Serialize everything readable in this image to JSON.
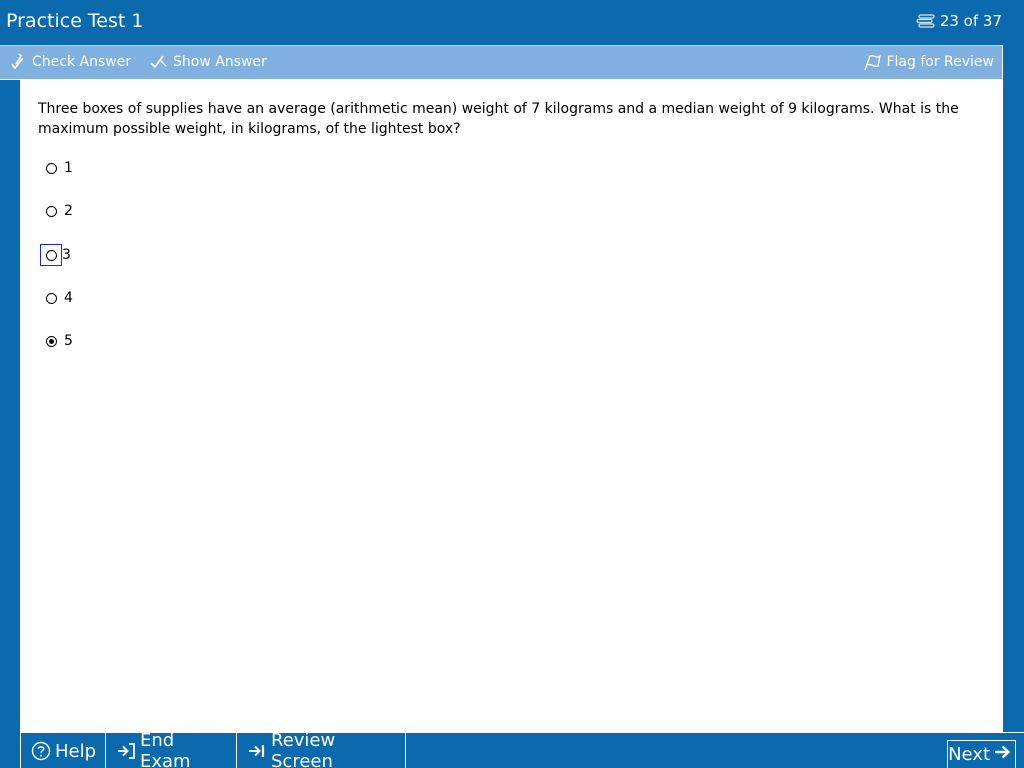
{
  "header": {
    "title": "Practice Test 1",
    "progress": "23 of 37",
    "progress_icon": "list-icon"
  },
  "toolbar": {
    "check_answer_label": "Check Answer",
    "check_answer_icon": "checkmark-pen-icon",
    "show_answer_label": "Show Answer",
    "show_answer_icon": "checkmark-pen-icon",
    "flag_label": "Flag for Review",
    "flag_icon": "flag-icon"
  },
  "question": {
    "text": "Three boxes of supplies have an average (arithmetic mean) weight of 7 kilograms and a median weight of 9 kilograms.  What is the maximum possible weight, in kilograms, of the lightest box?",
    "options": [
      {
        "label": "1",
        "selected": false,
        "focused": false
      },
      {
        "label": "2",
        "selected": false,
        "focused": false
      },
      {
        "label": "3",
        "selected": false,
        "focused": true
      },
      {
        "label": "4",
        "selected": false,
        "focused": false
      },
      {
        "label": "5",
        "selected": true,
        "focused": false
      }
    ]
  },
  "footer": {
    "help_label": "Help",
    "help_icon": "question-circle-icon",
    "end_exam_label": "End Exam",
    "end_exam_icon": "exit-arrow-icon",
    "review_label": "Review Screen",
    "review_icon": "arrow-to-bar-icon",
    "next_label": "Next",
    "next_icon": "arrow-right-icon"
  },
  "colors": {
    "brand_blue": "#0a6aad",
    "toolbar_blue": "#7fb0e0",
    "focus_border": "#1a2ec0"
  }
}
